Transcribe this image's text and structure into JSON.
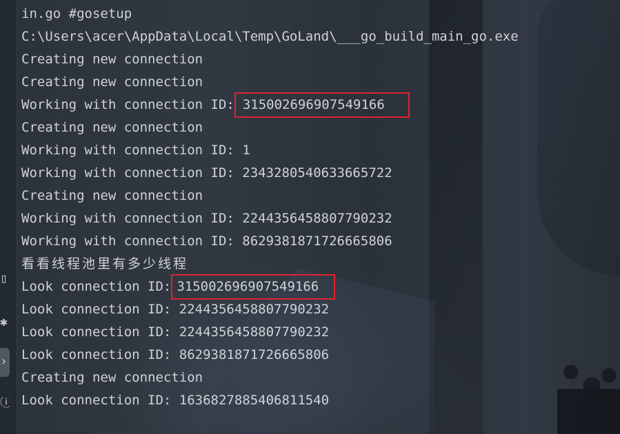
{
  "console": {
    "lines": [
      {
        "text": "in.go #gosetup"
      },
      {
        "text": "C:\\Users\\acer\\AppData\\Local\\Temp\\GoLand\\___go_build_main_go.exe"
      },
      {
        "text": "Creating new connection"
      },
      {
        "text": "Creating new connection"
      },
      {
        "prefix": "Working with connection ID:",
        "value": "315002696907549166"
      },
      {
        "text": "Creating new connection"
      },
      {
        "text": "Working with connection ID: 1"
      },
      {
        "text": "Working with connection ID: 2343280540633665722"
      },
      {
        "text": "Creating new connection"
      },
      {
        "text": "Working with connection ID: 2244356458807790232"
      },
      {
        "text": "Working with connection ID: 8629381871726665806"
      },
      {
        "text": "看看线程池里有多少线程"
      },
      {
        "prefix": "Look connection ID:",
        "value": "315002696907549166"
      },
      {
        "text": "Look connection ID: 2244356458807790232"
      },
      {
        "text": "Look connection ID: 2244356458807790232"
      },
      {
        "text": "Look connection ID: 8629381871726665806"
      },
      {
        "text": "Creating new connection"
      },
      {
        "text": "Look connection ID: 1636827885406811540"
      }
    ]
  },
  "highlight_color": "#e0232f",
  "text_color": "#cfd3d8",
  "gutter_icons": [
    "window-icon",
    "bug-icon",
    "terminal-icon",
    "info-icon"
  ]
}
